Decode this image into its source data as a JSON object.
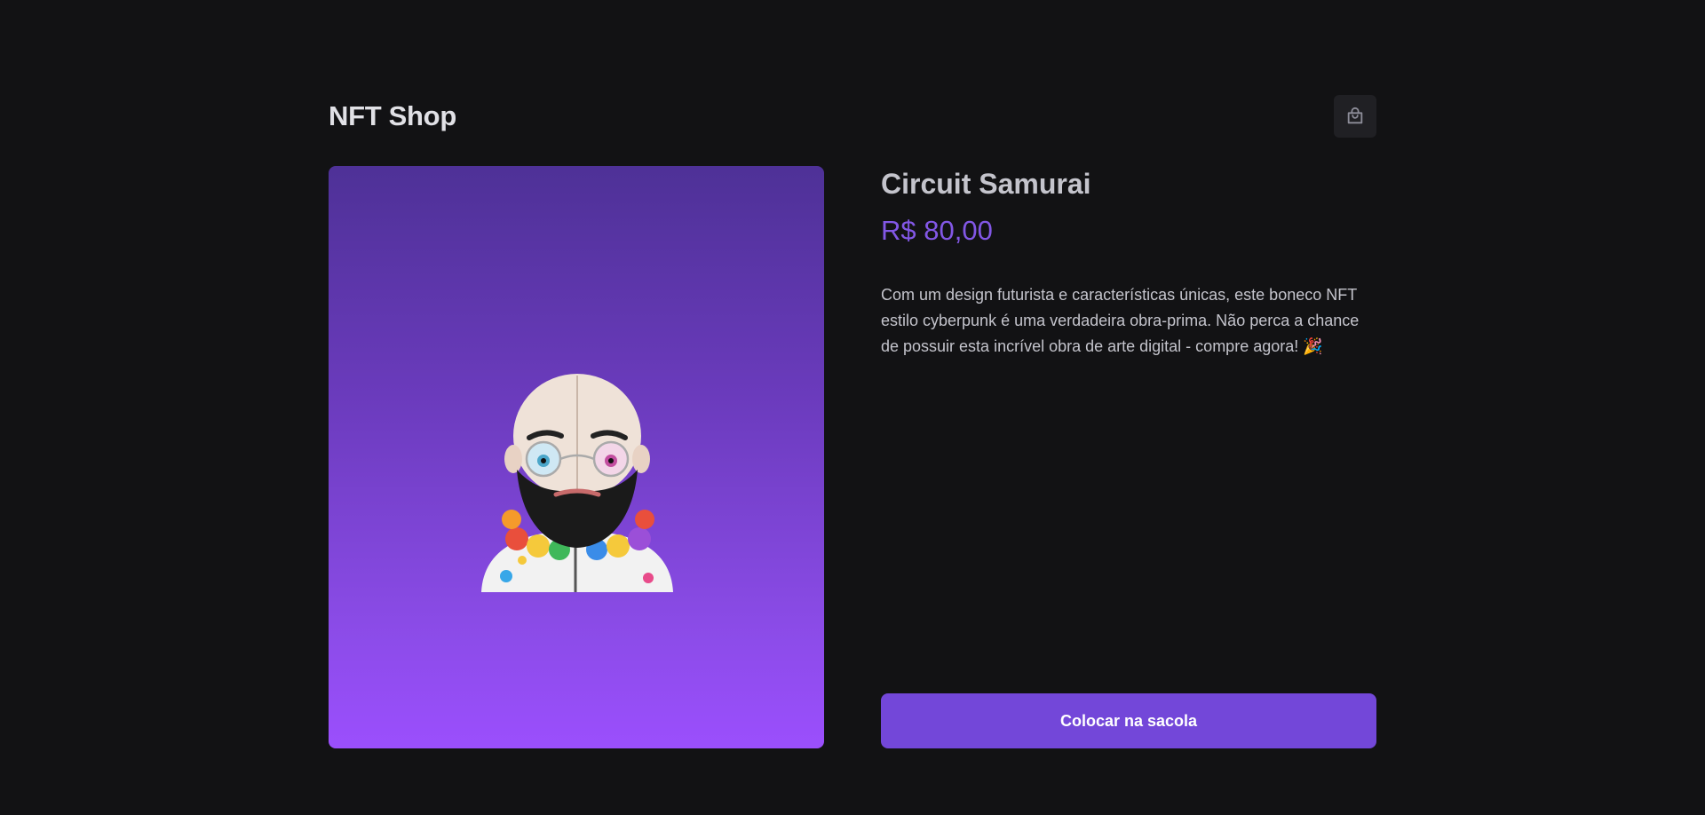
{
  "header": {
    "logo": "NFT Shop",
    "bag_icon": "shopping-bag-icon"
  },
  "product": {
    "image_icon": "nft-avatar-image",
    "title": "Circuit Samurai",
    "price": "R$ 80,00",
    "description": "Com um design futurista e características únicas, este boneco NFT estilo cyberpunk é uma verdadeira obra-prima. Não perca a chance de possuir esta incrível obra de arte digital - compre agora! 🎉",
    "buy_label": "Colocar na sacola"
  },
  "colors": {
    "background": "#121214",
    "accent": "#8257e5",
    "button": "#7347d9",
    "card_gradient_top": "#4e3197",
    "card_gradient_bottom": "#9b4ffd"
  }
}
